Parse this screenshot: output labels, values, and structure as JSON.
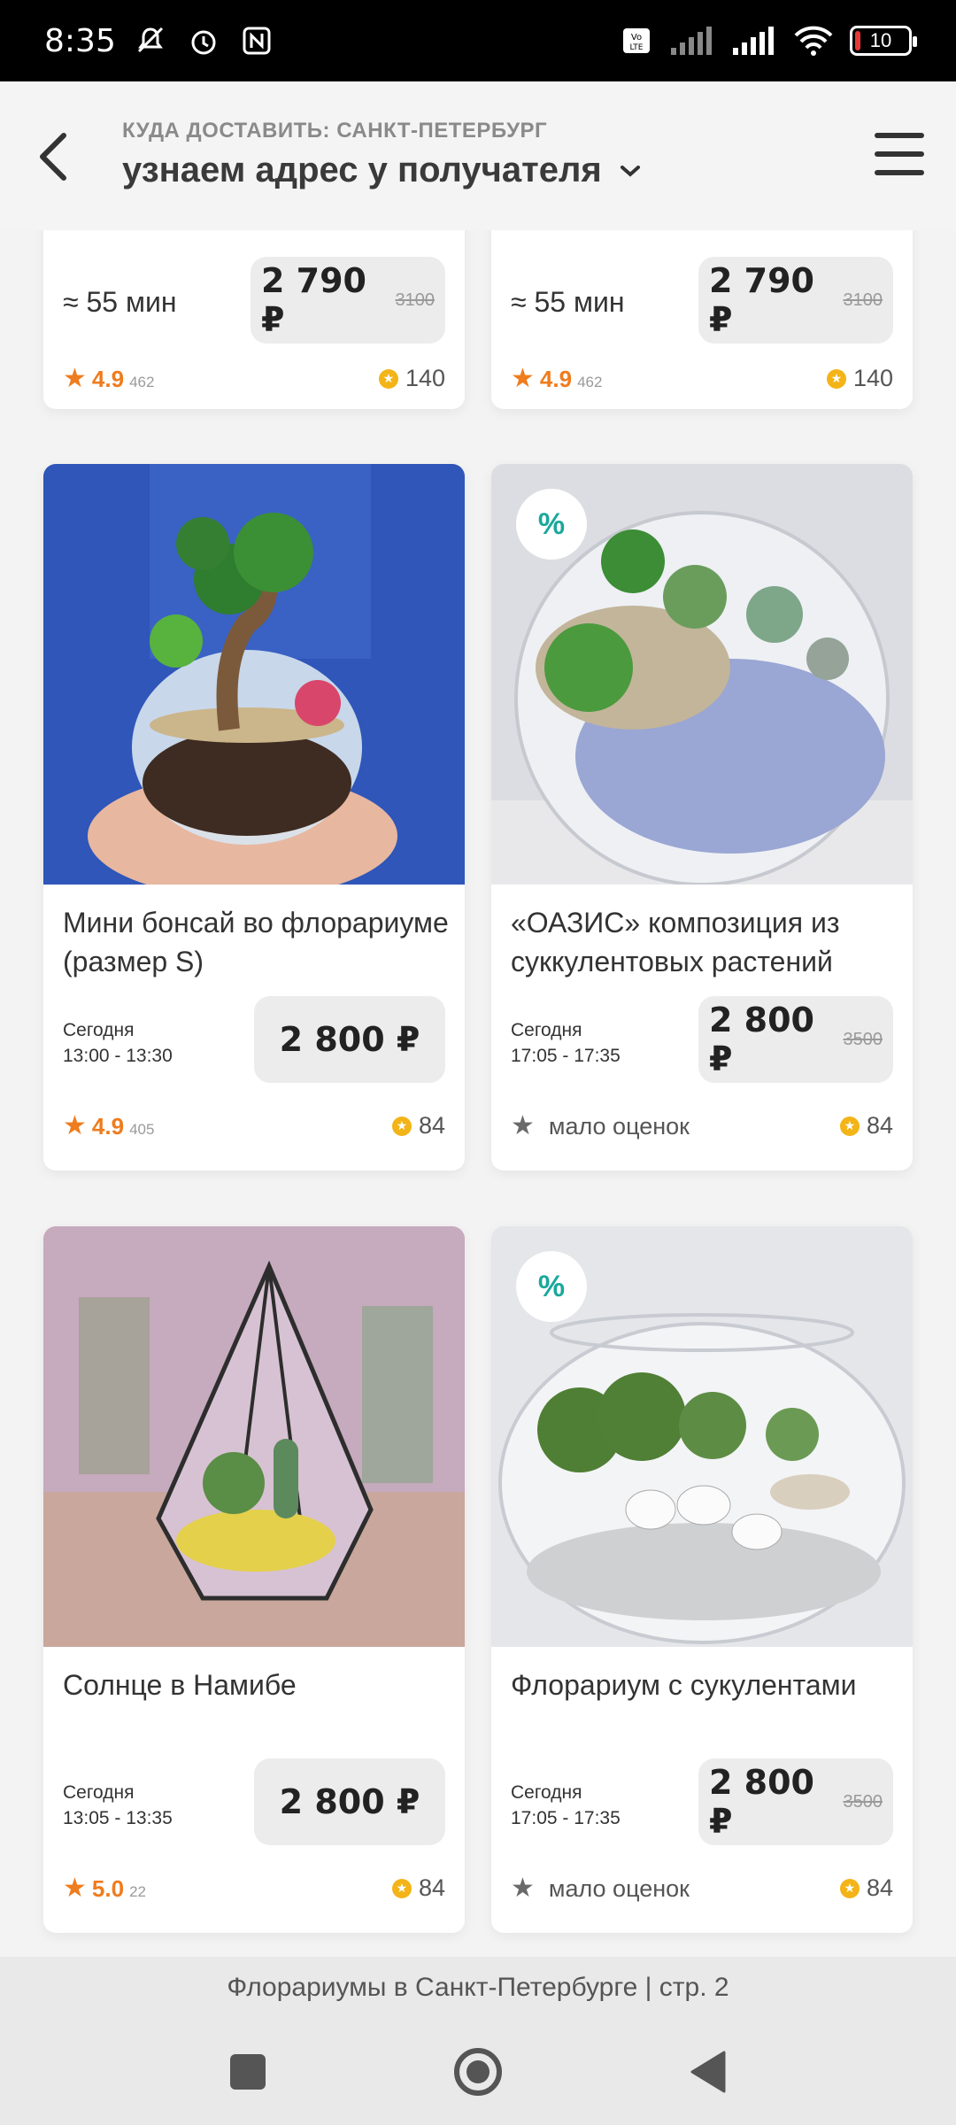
{
  "status_bar": {
    "time": "8:35",
    "battery": "10",
    "icons": [
      "mute-icon",
      "alarm-icon",
      "nfc-icon",
      "volte-icon",
      "signal-icon",
      "signal-icon",
      "wifi-icon",
      "battery-icon"
    ]
  },
  "header": {
    "caption": "КУДА ДОСТАВИТЬ: САНКТ-ПЕТЕРБУРГ",
    "address": "узнаем адрес у получателя"
  },
  "top_cards": [
    {
      "eta": "≈ 55 мин",
      "price": "2 790 ₽",
      "old_price": "3100",
      "rating": "4.9",
      "rating_count": "462",
      "bonus": "140"
    },
    {
      "eta": "≈ 55 мин",
      "price": "2 790 ₽",
      "old_price": "3100",
      "rating": "4.9",
      "rating_count": "462",
      "bonus": "140"
    }
  ],
  "products": [
    {
      "title": "Мини бонсай во флорариуме (размер S)",
      "day": "Сегодня",
      "time": "13:00 - 13:30",
      "price": "2 800 ₽",
      "old_price": "",
      "rating": "4.9",
      "rating_count": "405",
      "few_ratings": "",
      "bonus": "84",
      "sale": ""
    },
    {
      "title": "«ОАЗИС» композиция из суккулентовых растений",
      "day": "Сегодня",
      "time": "17:05 - 17:35",
      "price": "2 800 ₽",
      "old_price": "3500",
      "rating": "",
      "rating_count": "",
      "few_ratings": "мало оценок",
      "bonus": "84",
      "sale": "%"
    },
    {
      "title": "Солнце в Намибе",
      "day": "Сегодня",
      "time": "13:05 - 13:35",
      "price": "2 800 ₽",
      "old_price": "",
      "rating": "5.0",
      "rating_count": "22",
      "few_ratings": "",
      "bonus": "84",
      "sale": ""
    },
    {
      "title": "Флорариум с сукулентами",
      "day": "Сегодня",
      "time": "17:05 - 17:35",
      "price": "2 800 ₽",
      "old_price": "3500",
      "rating": "",
      "rating_count": "",
      "few_ratings": "мало оценок",
      "bonus": "84",
      "sale": "%"
    }
  ],
  "footer": {
    "page_label": "Флорариумы в Санкт-Петербурге | стр. 2"
  },
  "colors": {
    "accent_orange": "#ef7c1e",
    "sale_teal": "#1aa79c",
    "coin_yellow": "#f3b418"
  }
}
